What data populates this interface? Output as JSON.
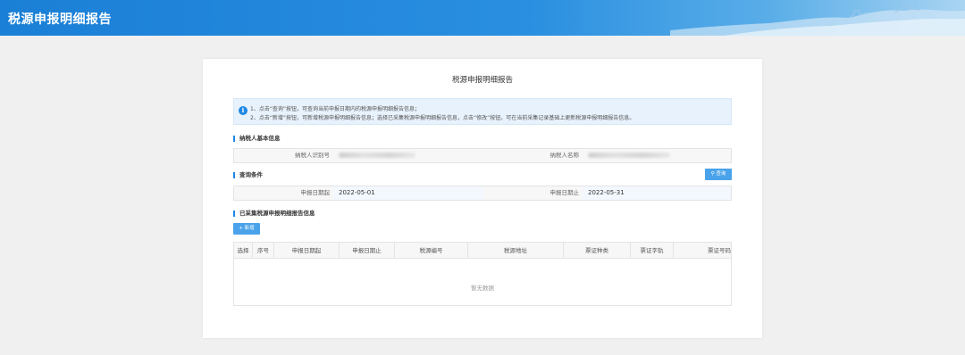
{
  "app": {
    "title": "税源申报明细报告"
  },
  "page": {
    "title": "税源申报明细报告"
  },
  "notice": {
    "icon": "info-icon",
    "line1": "1、点击“查询”按钮，可查询当前申报日期内的税源申报明细报告信息；",
    "line2": "2、点击“新增”按钮，可新增税源申报明细报告信息；选择已采集税源申报明细报告信息，点击“修改”按钮，可在当前采集记录基础上更新税源申报明细报告信息。"
  },
  "taxpayer": {
    "section_title": "纳税人基本信息",
    "id_label": "纳税人识别号",
    "name_label": "纳税人名称"
  },
  "query": {
    "section_title": "查询条件",
    "search_button": "查询",
    "start_label": "申报日期起",
    "start_value": "2022-05-01",
    "end_label": "申报日期止",
    "end_value": "2022-05-31"
  },
  "records": {
    "section_title": "已采集税源申报明细报告信息",
    "add_button": "+ 新增",
    "columns": [
      "选择",
      "序号",
      "申报日期起",
      "申报日期止",
      "税源编号",
      "税源地址",
      "票证种类",
      "票证字轨",
      "票证号码"
    ],
    "empty_text": "暂无数据"
  },
  "colors": {
    "accent": "#1e88e5",
    "button": "#4aa3ea",
    "header": "#1a7fd6"
  }
}
